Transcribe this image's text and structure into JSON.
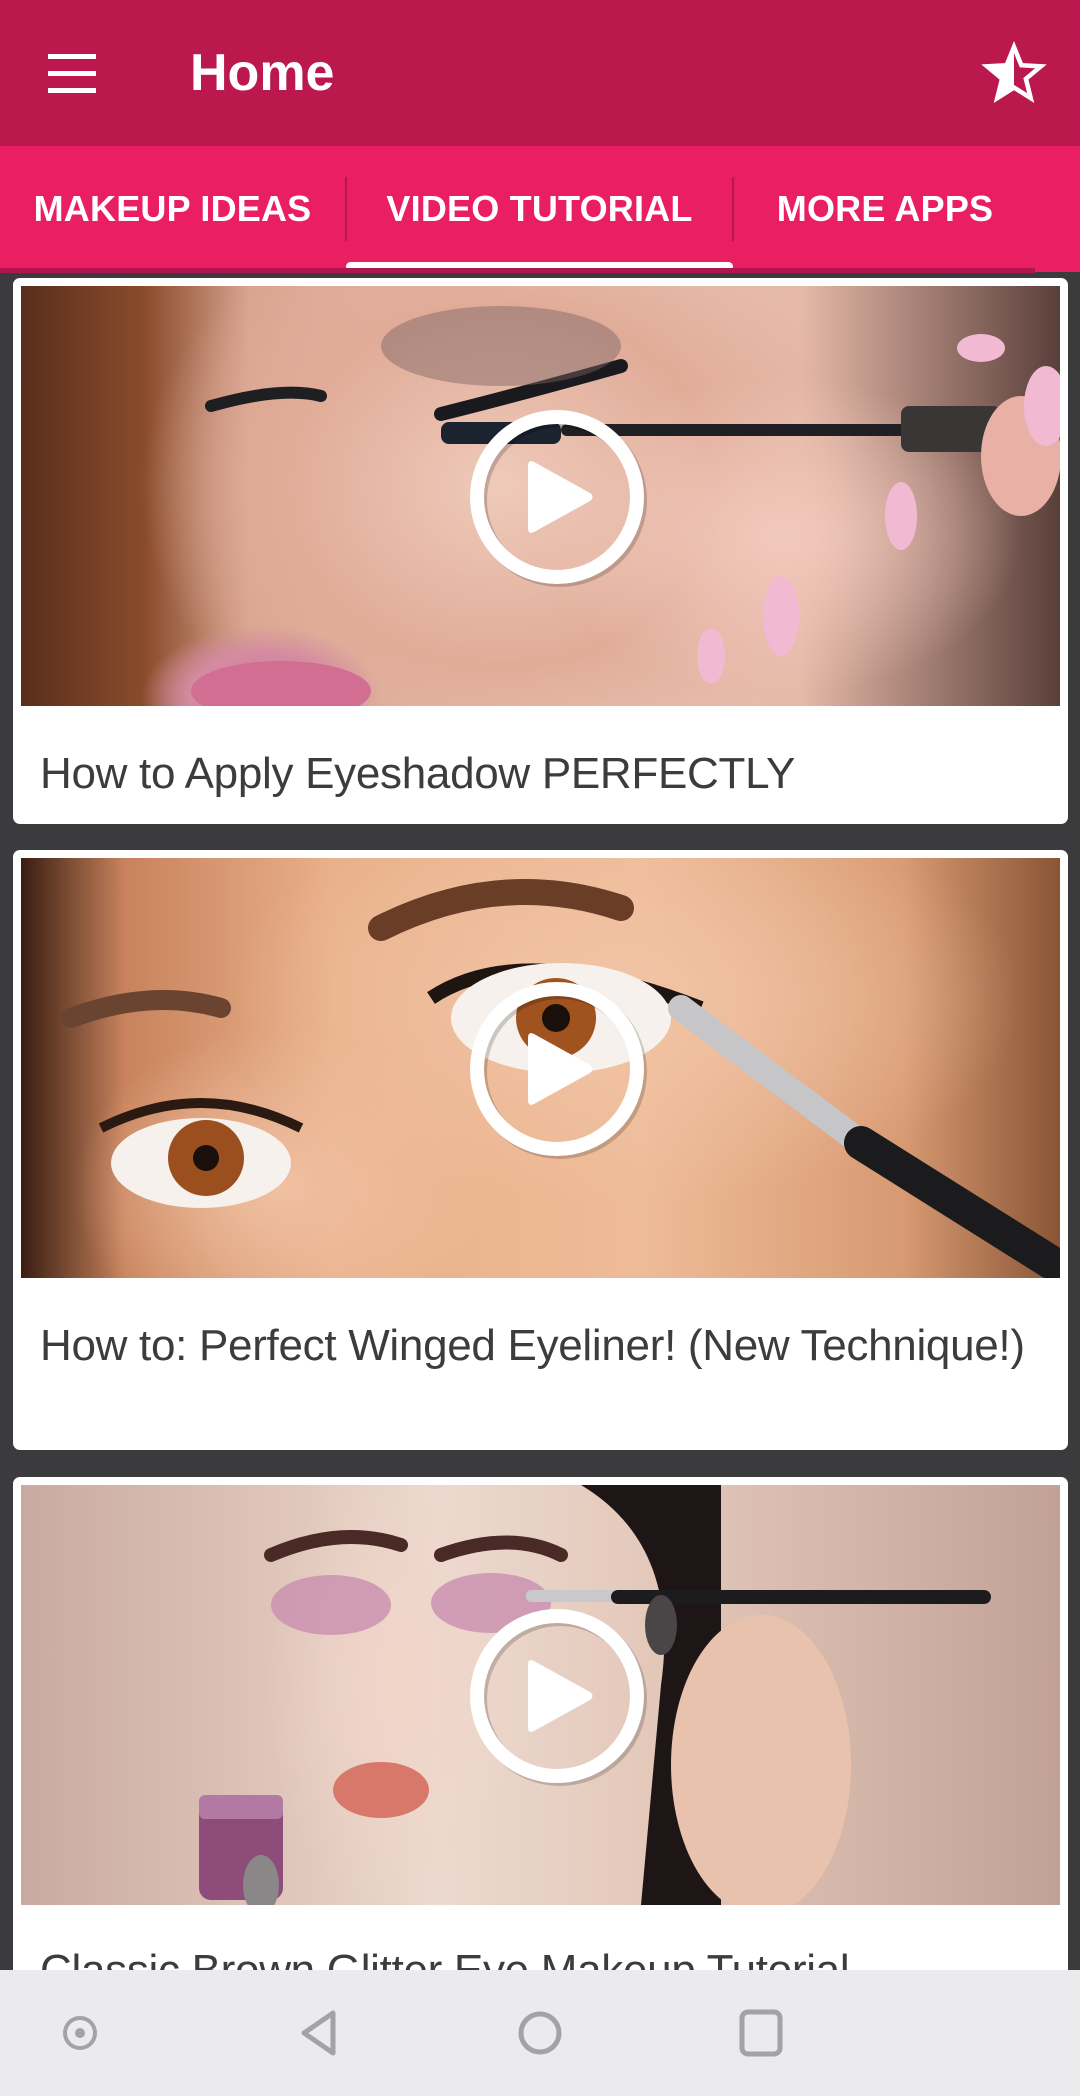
{
  "app_bar": {
    "title": "Home",
    "menu_icon": "hamburger-menu-icon",
    "rate_icon": "half-star-rate-icon",
    "color": "#bb184e"
  },
  "tabs": {
    "color": "#e91e63",
    "items": [
      {
        "label": "MAKEUP IDEAS",
        "selected": false
      },
      {
        "label": "VIDEO TUTORIAL",
        "selected": true
      },
      {
        "label": "MORE APPS",
        "selected": false
      }
    ]
  },
  "videos": [
    {
      "title": "How to Apply Eyeshadow PERFECTLY",
      "thumbnail": "mascara-application-closeup",
      "overlay_icon": "play-circle-icon"
    },
    {
      "title": "How to: Perfect Winged Eyeliner! (New Technique!)",
      "thumbnail": "brown-eye-brush-closeup",
      "overlay_icon": "play-circle-icon"
    },
    {
      "title": "Classic Brown Glitter Eye Makeup Tutorial",
      "thumbnail": "glitter-eyeshadow-model",
      "overlay_icon": "play-circle-icon"
    }
  ],
  "system_nav": {
    "buttons": [
      "assistant-dot-icon",
      "back-icon",
      "home-icon",
      "recents-icon"
    ]
  }
}
